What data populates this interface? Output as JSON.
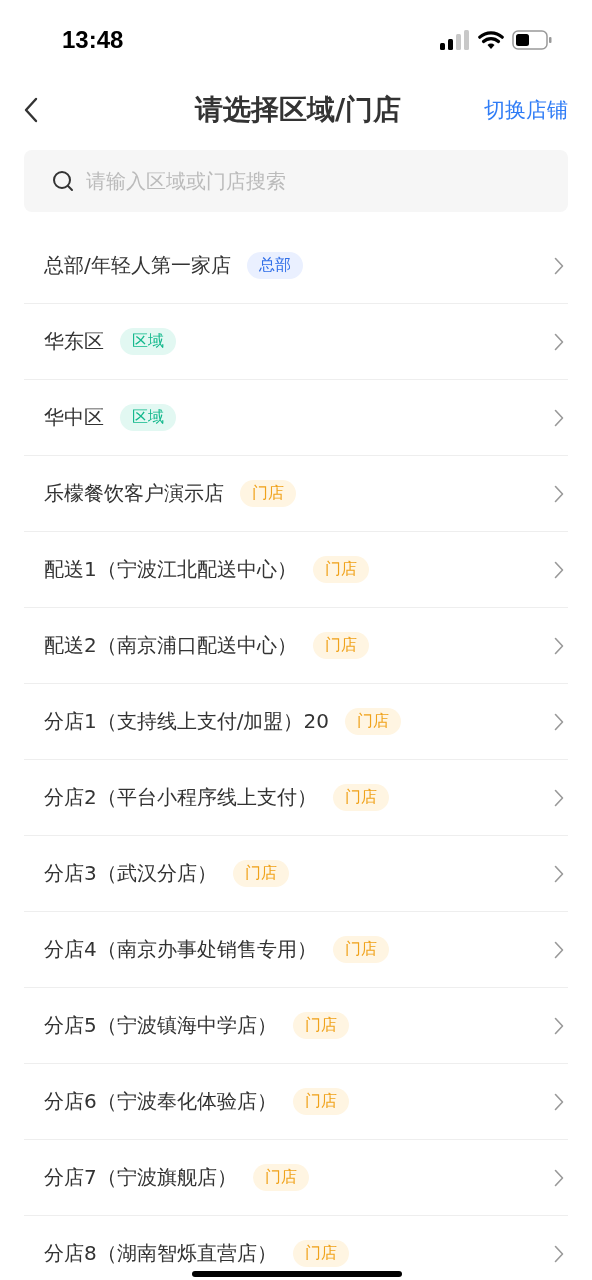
{
  "status_bar": {
    "time": "13:48"
  },
  "nav": {
    "title": "请选择区域/门店",
    "action": "切换店铺"
  },
  "search": {
    "placeholder": "请输入区域或门店搜索"
  },
  "items": [
    {
      "name": "总部/年轻人第一家店",
      "tag": "总部",
      "kind": "hq"
    },
    {
      "name": "华东区",
      "tag": "区域",
      "kind": "region"
    },
    {
      "name": "华中区",
      "tag": "区域",
      "kind": "region"
    },
    {
      "name": "乐檬餐饮客户演示店",
      "tag": "门店",
      "kind": "store"
    },
    {
      "name": "配送1（宁波江北配送中心）",
      "tag": "门店",
      "kind": "store"
    },
    {
      "name": "配送2（南京浦口配送中心）",
      "tag": "门店",
      "kind": "store"
    },
    {
      "name": "分店1（支持线上支付/加盟）20",
      "tag": "门店",
      "kind": "store"
    },
    {
      "name": "分店2（平台小程序线上支付）",
      "tag": "门店",
      "kind": "store"
    },
    {
      "name": "分店3（武汉分店）",
      "tag": "门店",
      "kind": "store"
    },
    {
      "name": "分店4（南京办事处销售专用）",
      "tag": "门店",
      "kind": "store"
    },
    {
      "name": "分店5（宁波镇海中学店）",
      "tag": "门店",
      "kind": "store"
    },
    {
      "name": "分店6（宁波奉化体验店）",
      "tag": "门店",
      "kind": "store"
    },
    {
      "name": "分店7（宁波旗舰店）",
      "tag": "门店",
      "kind": "store"
    },
    {
      "name": "分店8（湖南智烁直营店）",
      "tag": "门店",
      "kind": "store"
    }
  ]
}
